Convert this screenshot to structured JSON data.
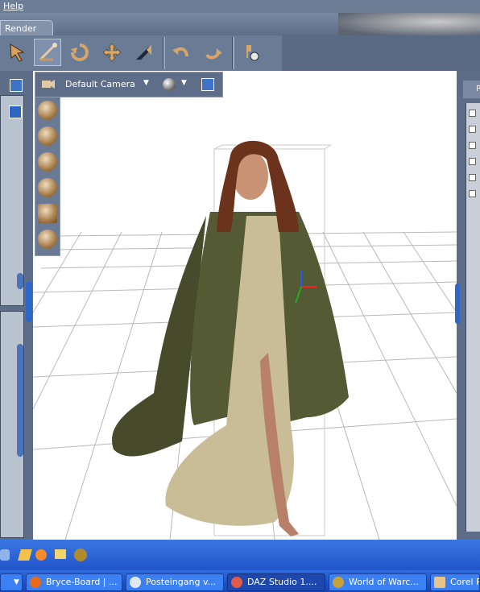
{
  "menu": {
    "help": "Help"
  },
  "tabs": {
    "render": "Render"
  },
  "toolbar": {
    "tools": [
      {
        "icon": "select-arrow-icon"
      },
      {
        "icon": "transform-universal-icon",
        "selected": true
      },
      {
        "icon": "rotate-icon"
      },
      {
        "icon": "translate-icon"
      },
      {
        "icon": "scale-icon"
      },
      {
        "icon": "undo-icon"
      },
      {
        "icon": "redo-icon"
      },
      {
        "icon": "pose-tool-icon"
      }
    ]
  },
  "viewport": {
    "camera": "Default Camera"
  },
  "right_panel": {
    "title": "P"
  },
  "taskbar": {
    "items": [
      {
        "label": "",
        "icon": "start-arrow-icon"
      },
      {
        "label": "Bryce-Board | ...",
        "icon": "firefox-icon"
      },
      {
        "label": "Posteingang v...",
        "icon": "mail-icon"
      },
      {
        "label": "DAZ Studio 1....",
        "icon": "daz-studio-icon",
        "active": true
      },
      {
        "label": "World of Warc...",
        "icon": "wow-icon"
      },
      {
        "label": "Corel P",
        "icon": "corel-icon"
      }
    ]
  },
  "colors": {
    "ui_blue": "#5d6d88",
    "taskbar": "#2155c9",
    "accent": "#4a73b8"
  }
}
